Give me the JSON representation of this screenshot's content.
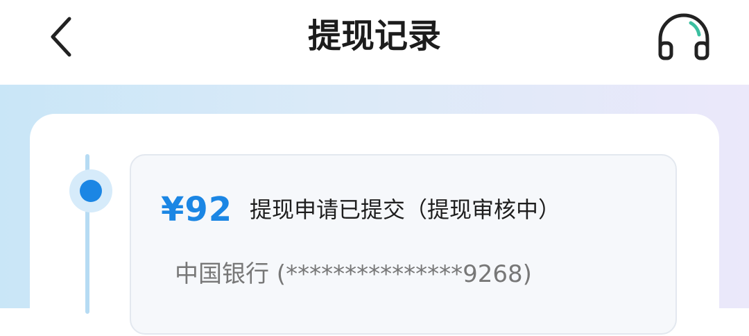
{
  "header": {
    "title": "提现记录",
    "back_icon": "chevron-left-icon",
    "support_icon": "headphones-icon"
  },
  "records": [
    {
      "amount": "¥92",
      "status": "提现申请已提交（提现审核中）",
      "bank": "中国银行 (***************9268)"
    }
  ],
  "colors": {
    "accent": "#1b86e4",
    "timeline_line": "#b6dbf3",
    "support_icon_accent": "#3bbfa0",
    "title_text": "#1c1c1c",
    "secondary_text": "#777777"
  }
}
